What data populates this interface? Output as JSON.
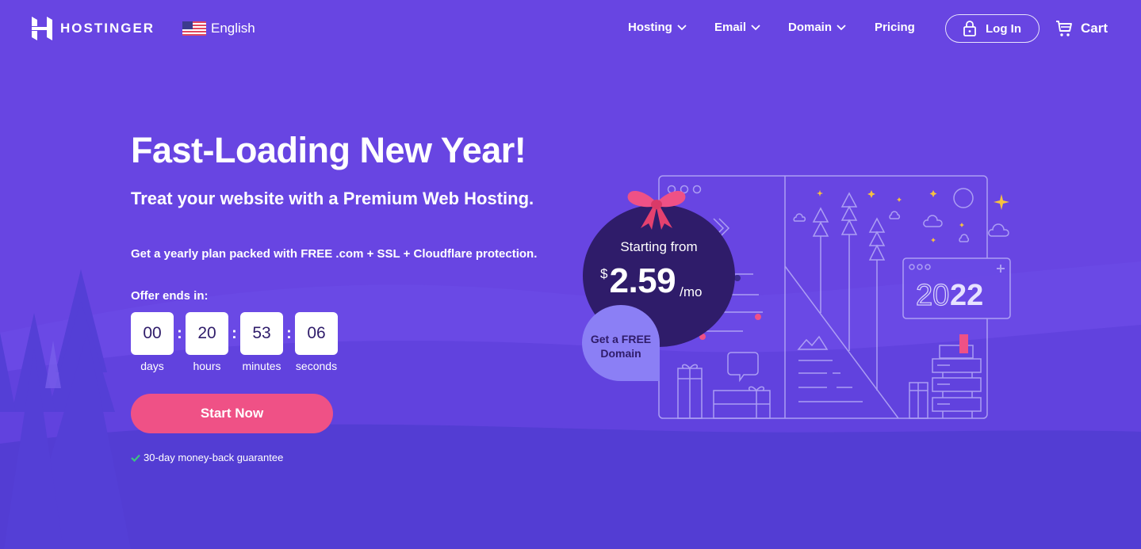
{
  "header": {
    "logo_text": "HOSTINGER",
    "language": "English",
    "nav": [
      {
        "label": "Hosting",
        "has_dropdown": true
      },
      {
        "label": "Email",
        "has_dropdown": true
      },
      {
        "label": "Domain",
        "has_dropdown": true
      },
      {
        "label": "Pricing",
        "has_dropdown": false
      }
    ],
    "login_label": "Log In",
    "cart_label": "Cart"
  },
  "hero": {
    "title": "Fast-Loading New Year!",
    "subtitle": "Treat your website with a Premium Web Hosting.",
    "description": "Get a yearly plan packed with FREE .com + SSL + Cloudflare protection.",
    "offer_label": "Offer ends in:",
    "countdown": [
      {
        "value": "00",
        "label": "days"
      },
      {
        "value": "20",
        "label": "hours"
      },
      {
        "value": "53",
        "label": "minutes"
      },
      {
        "value": "06",
        "label": "seconds"
      }
    ],
    "separator": ":",
    "cta_label": "Start Now",
    "guarantee": "30-day money-back guarantee"
  },
  "promo": {
    "starting_from": "Starting from",
    "currency": "$",
    "price": "2.59",
    "period": "/mo",
    "free_domain_line1": "Get a FREE",
    "free_domain_line2": "Domain",
    "year_outline": "20",
    "year_bold": "22"
  },
  "colors": {
    "background": "#6845e2",
    "cta": "#ef5186",
    "price_badge": "#2f1c6a",
    "free_domain_badge": "#8b7ff5",
    "check": "#3cc480"
  }
}
